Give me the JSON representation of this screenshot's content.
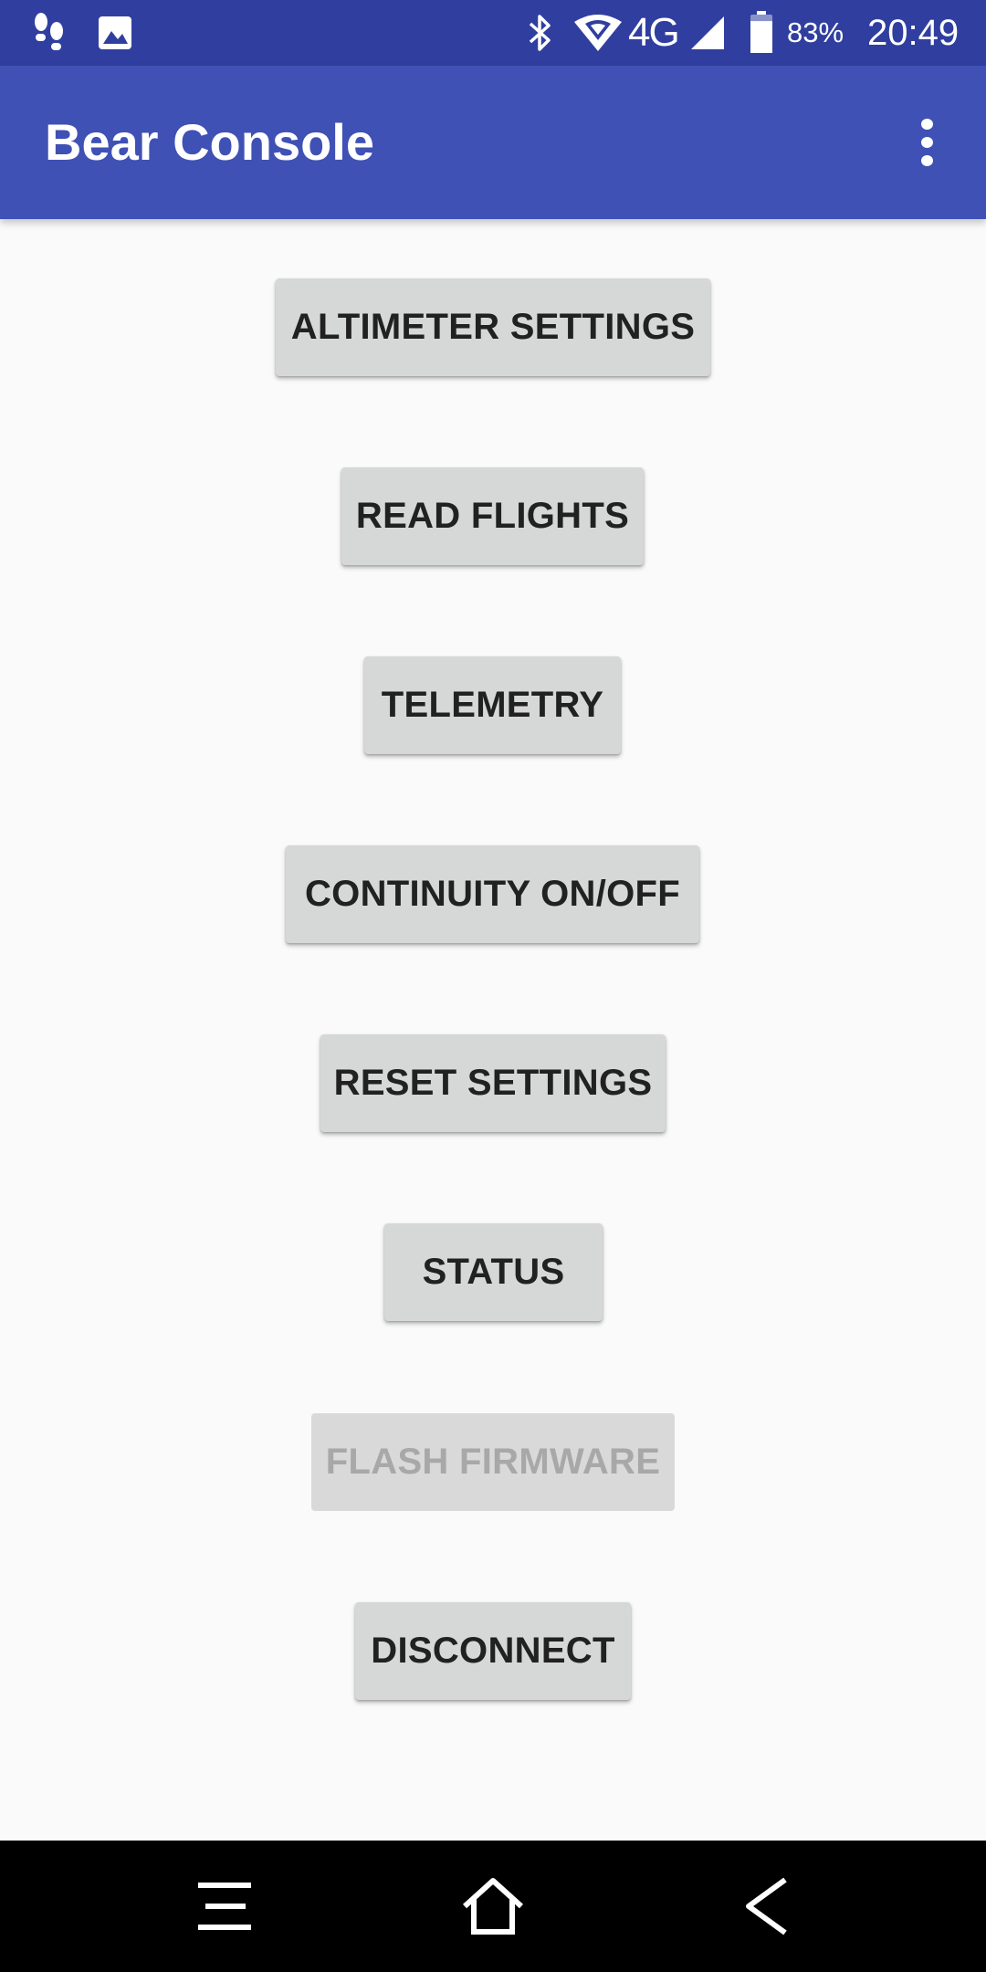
{
  "status_bar": {
    "time": "20:49",
    "battery_percent": "83%",
    "network": "4G",
    "battery_level": 0.83,
    "icons": [
      "footprints-icon",
      "image-icon",
      "bluetooth-icon",
      "wifi-icon",
      "signal-icon",
      "battery-icon"
    ]
  },
  "app_bar": {
    "title": "Bear Console",
    "overflow_icon": "more-vert-icon"
  },
  "menu": {
    "altimeter_settings": "ALTIMETER SETTINGS",
    "read_flights": "READ FLIGHTS",
    "telemetry": "TELEMETRY",
    "continuity": "CONTINUITY ON/OFF",
    "reset_settings": "RESET SETTINGS",
    "status": "STATUS",
    "flash_firmware": "FLASH FIRMWARE",
    "disconnect": "DISCONNECT"
  },
  "nav_bar": {
    "icons": [
      "menu-icon",
      "home-icon",
      "back-icon"
    ]
  },
  "colors": {
    "status_bar": "#303f9f",
    "app_bar": "#3f51b5",
    "button": "#d6d7d7",
    "background": "#fafafa"
  }
}
